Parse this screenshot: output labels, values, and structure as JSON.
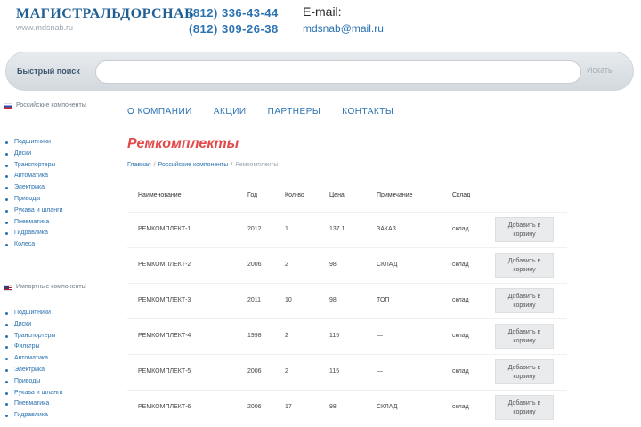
{
  "header": {
    "logo": "МАГИСТРАЛЬДОРСНАБ",
    "logo_sub": "www.mdsnab.ru",
    "phone_1": "(812) 336-43-44",
    "phone_2": "(812) 309-26-38",
    "email_label": "E-mail:",
    "email_value": "mdsnab@mail.ru"
  },
  "search": {
    "label": "Быстрый поиск",
    "placeholder": "",
    "button": "Искать"
  },
  "sidebar": {
    "section_1": {
      "title": "Российские компоненты",
      "items": [
        "Подшипники",
        "Диски",
        "Транспортеры",
        "Автоматика",
        "Электрика",
        "Приводы",
        "Рукава и шланги",
        "Пневматика",
        "Гидравлика",
        "Колеса"
      ]
    },
    "section_2": {
      "title": "Импортные компоненты",
      "items": [
        "Подшипники",
        "Диски",
        "Транспортеры",
        "Фильтры",
        "Автоматика",
        "Электрика",
        "Приводы",
        "Рукава и шланги",
        "Пневматика",
        "Гидравлика"
      ]
    }
  },
  "nav": {
    "items": [
      "О КОМПАНИИ",
      "АКЦИИ",
      "ПАРТНЕРЫ",
      "КОНТАКТЫ"
    ]
  },
  "page": {
    "title": "Ремкомплекты",
    "breadcrumb": [
      "Главная",
      "Российские компоненты",
      "Ремкомплекты"
    ]
  },
  "table": {
    "headers": [
      "Наименование",
      "Год",
      "Кол-во",
      "Цена",
      "Примечание",
      "Склад"
    ],
    "cart_label": "Добавить в корзину",
    "rows": [
      {
        "name": "РЕМКОМПЛЕКТ-1",
        "year": "2012",
        "qty": "1",
        "price": "137.1",
        "note": "ЗАКАЗ",
        "stock": "склад"
      },
      {
        "name": "РЕМКОМПЛЕКТ-2",
        "year": "2006",
        "qty": "2",
        "price": "98",
        "note": "СКЛАД",
        "stock": "склад"
      },
      {
        "name": "РЕМКОМПЛЕКТ-3",
        "year": "2011",
        "qty": "10",
        "price": "98",
        "note": "ТОП",
        "stock": "склад"
      },
      {
        "name": "РЕМКОМПЛЕКТ-4",
        "year": "1998",
        "qty": "2",
        "price": "115",
        "note": "—",
        "stock": "склад"
      },
      {
        "name": "РЕМКОМПЛЕКТ-5",
        "year": "2006",
        "qty": "2",
        "price": "115",
        "note": "—",
        "stock": "склад"
      },
      {
        "name": "РЕМКОМПЛЕКТ-6",
        "year": "2006",
        "qty": "17",
        "price": "98",
        "note": "СКЛАД",
        "stock": "склад"
      }
    ]
  }
}
